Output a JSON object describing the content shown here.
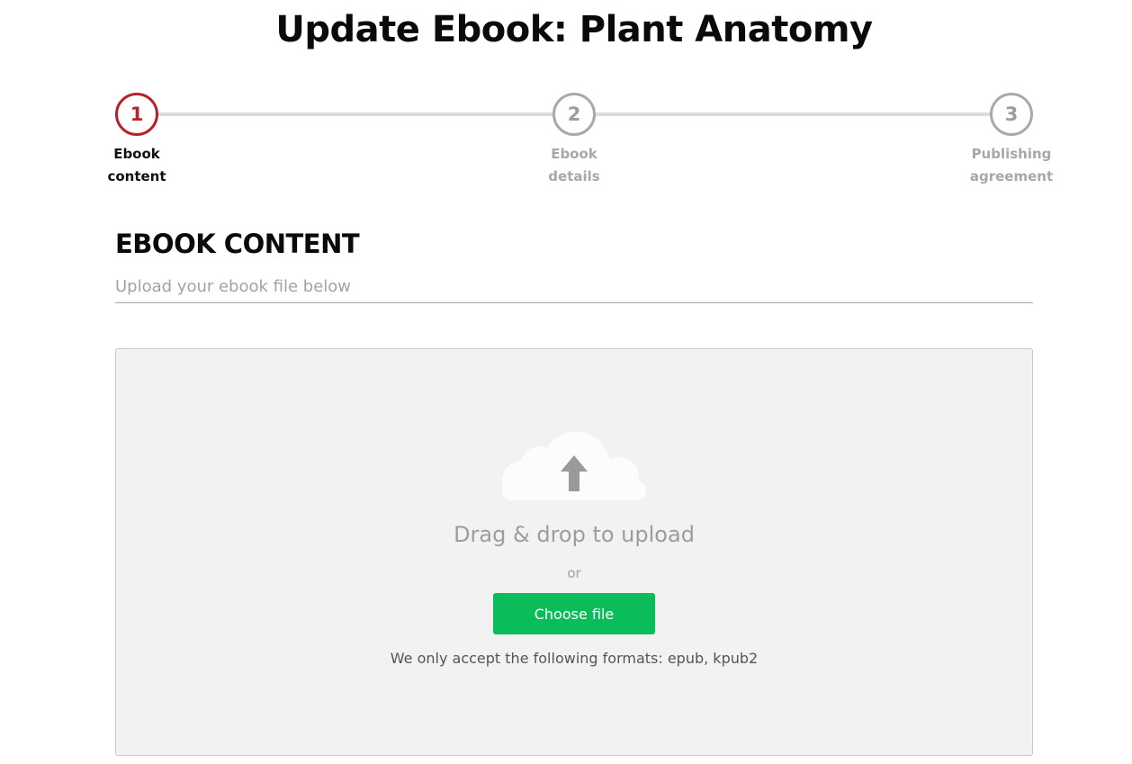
{
  "page": {
    "title": "Update Ebook: Plant Anatomy"
  },
  "stepper": {
    "steps": [
      {
        "number": "1",
        "label": "Ebook\ncontent",
        "state": "active"
      },
      {
        "number": "2",
        "label": "Ebook\ndetails",
        "state": "inactive"
      },
      {
        "number": "3",
        "label": "Publishing\nagreement",
        "state": "inactive"
      }
    ]
  },
  "section": {
    "title": "EBOOK CONTENT",
    "subtitle": "Upload your ebook file below"
  },
  "dropzone": {
    "icon": "cloud-upload-icon",
    "title": "Drag & drop to upload",
    "or_text": "or",
    "button_label": "Choose file",
    "formats_text": "We only accept the following formats: epub, kpub2"
  },
  "colors": {
    "accent_active": "#b5222b",
    "inactive": "#a9a9a9",
    "button_green": "#0bbd5a",
    "dropzone_bg": "#f2f2f2"
  }
}
